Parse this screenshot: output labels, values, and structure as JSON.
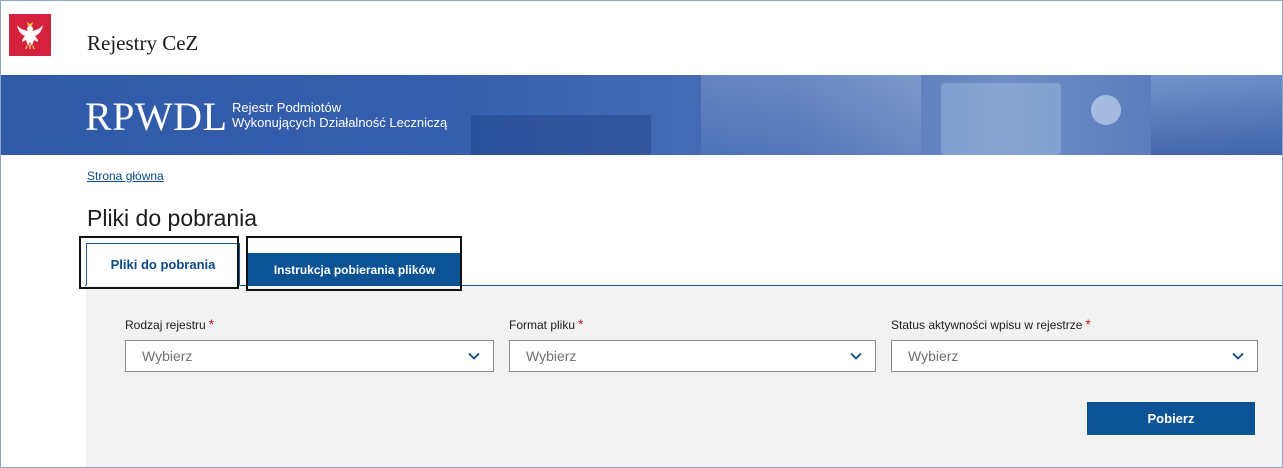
{
  "header": {
    "system_title": "Rejestry CeZ",
    "emblem_icon": "polish-eagle-emblem-icon"
  },
  "banner": {
    "acronym": "RPWDL",
    "fullname_line1": "Rejestr Podmiotów",
    "fullname_line2": "Wykonujących Działalność Leczniczą"
  },
  "breadcrumb": {
    "home": "Strona główna"
  },
  "page": {
    "title": "Pliki do pobrania"
  },
  "tabs": [
    {
      "label": "Pliki do pobrania",
      "active": true
    },
    {
      "label": "Instrukcja pobierania plików",
      "active": false
    }
  ],
  "form": {
    "fields": [
      {
        "label": "Rodzaj rejestru",
        "required_mark": "*",
        "placeholder": "Wybierz"
      },
      {
        "label": "Format pliku",
        "required_mark": "*",
        "placeholder": "Wybierz"
      },
      {
        "label": "Status aktywności wpisu w rejestrze",
        "required_mark": "*",
        "placeholder": "Wybierz"
      }
    ],
    "submit_label": "Pobierz"
  },
  "colors": {
    "brand_blue": "#0b5394",
    "emblem_red": "#d4213d",
    "required_red": "#c3162d"
  }
}
